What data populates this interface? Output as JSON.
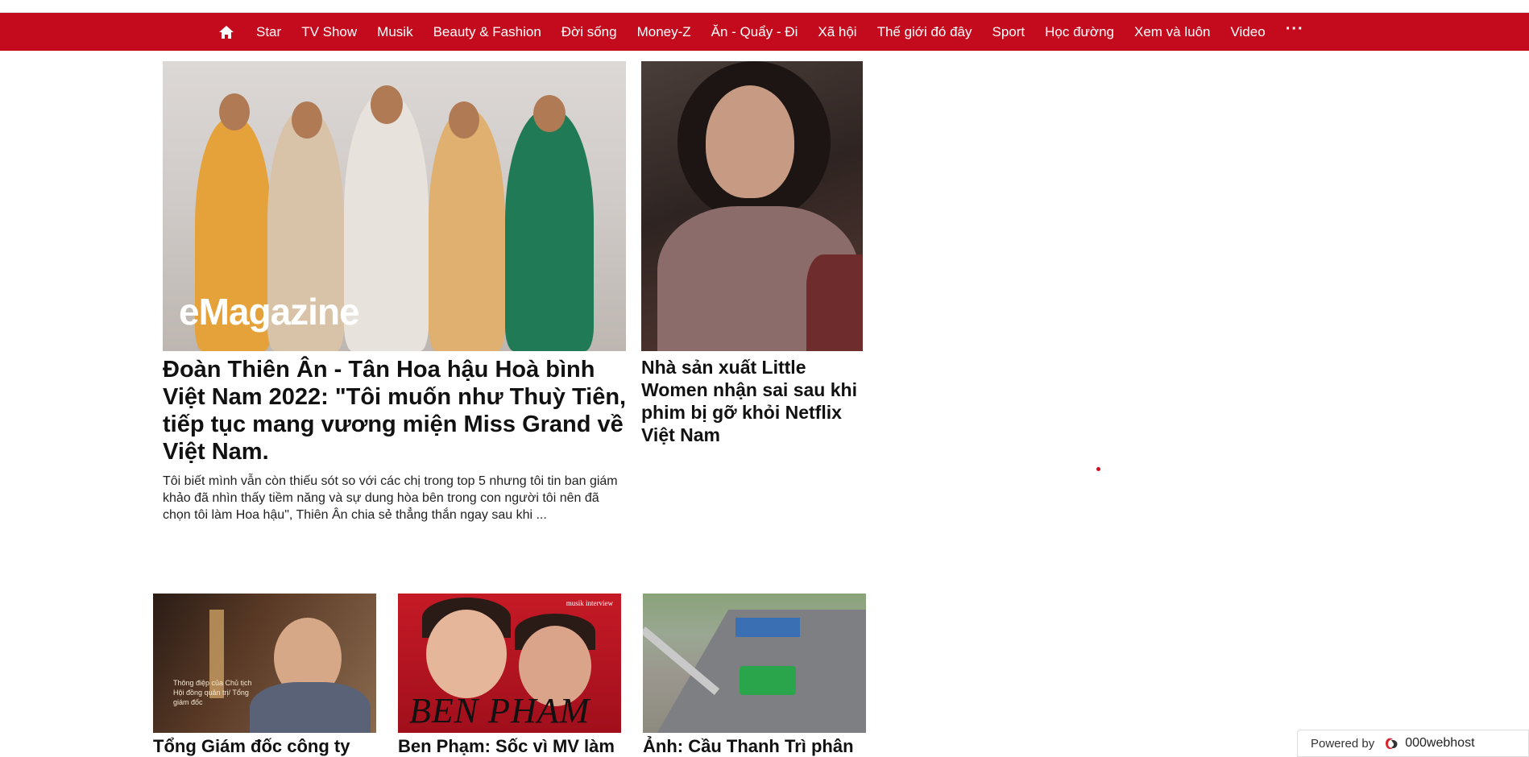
{
  "nav": {
    "items": [
      "Star",
      "TV Show",
      "Musik",
      "Beauty & Fashion",
      "Đời sống",
      "Money-Z",
      "Ăn - Quẩy - Đi",
      "Xã hội",
      "Thế giới đó đây",
      "Sport",
      "Học đường",
      "Xem và luôn",
      "Video"
    ],
    "more": "···",
    "home_icon": "home-icon",
    "bg_color": "#c30b1d"
  },
  "lead": {
    "image_text": "eMagazine",
    "title": "Đoàn Thiên Ân - Tân Hoa hậu Hoà bình Việt Nam 2022: \"Tôi muốn như Thuỳ Tiên, tiếp tục mang vương miện Miss Grand về Việt Nam.",
    "description": "Tôi biết mình vẫn còn thiếu sót so với các chị trong top 5 nhưng tôi tin ban giám khảo đã nhìn thấy tiềm năng và sự dung hòa bên trong con người tôi nên đã chọn tôi làm Hoa hậu\", Thiên Ân chia sẻ thẳng thắn ngay sau khi ..."
  },
  "side": {
    "title": "Nhà sản xuất Little Women nhận sai sau khi phim bị gỡ khỏi Netflix Việt Nam"
  },
  "cards": [
    {
      "title": "Tổng Giám đốc công ty",
      "image_caption": "Thông điệp của Chủ tịch Hội đồng quản trị/ Tổng giám đốc"
    },
    {
      "title": "Ben Phạm: Sốc vì MV làm",
      "image_caption": "BEN PHAM",
      "image_tag": "musik interview"
    },
    {
      "title": "Ảnh: Cầu Thanh Trì phân"
    }
  ],
  "footer": {
    "powered_label": "Powered by",
    "brand": "000webhost"
  }
}
